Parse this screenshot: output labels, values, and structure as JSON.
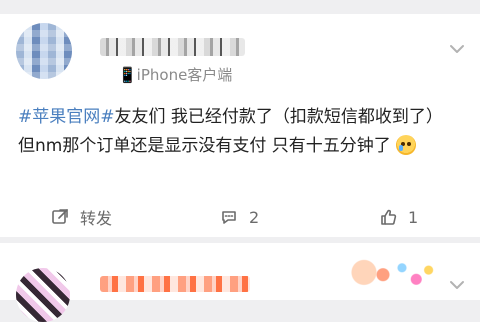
{
  "post": {
    "meta_text": "📱iPhone客户端",
    "content": {
      "topic": "#苹果官网#",
      "text_after_topic": "友友们 我已经付款了（扣款短信都收到了） 但nm那个订单还是显示没有支付 只有十五分钟了"
    },
    "actions": {
      "repost_label": "转发",
      "comment_count": "2",
      "like_count": "1"
    }
  }
}
